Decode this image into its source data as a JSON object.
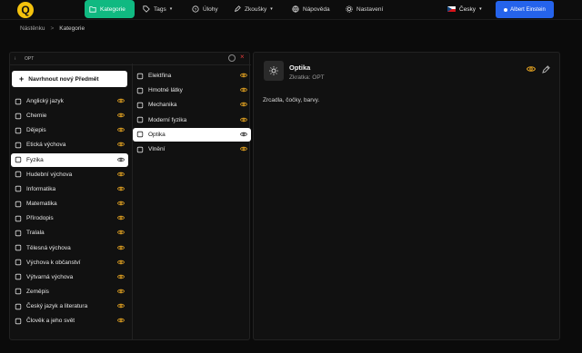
{
  "nav": {
    "items": [
      {
        "label": "Kategorie",
        "icon": "folder-icon"
      },
      {
        "label": "Tags",
        "icon": "tag-icon"
      },
      {
        "label": "Úlohy",
        "icon": "help-circle-icon"
      },
      {
        "label": "Zkoušky",
        "icon": "pen-icon"
      },
      {
        "label": "Nápověda",
        "icon": "globe-icon"
      },
      {
        "label": "Nastavení",
        "icon": "gear-icon"
      }
    ],
    "language": "Česky",
    "user": "Albert Einstein"
  },
  "breadcrumb": {
    "home": "Nástěnku",
    "current": "Kategorie"
  },
  "panel": {
    "code": "OPT",
    "new_button": "Navrhnout nový Předmět"
  },
  "subjects": [
    {
      "label": "Anglický jazyk",
      "icon": "translate-icon"
    },
    {
      "label": "Chemie",
      "icon": "flask-icon"
    },
    {
      "label": "Dějepis",
      "icon": "scroll-icon"
    },
    {
      "label": "Etická výchova",
      "icon": "heart-icon"
    },
    {
      "label": "Fyzika",
      "icon": "sparkles-icon",
      "selected": true
    },
    {
      "label": "Hudební výchova",
      "icon": "music-note-icon"
    },
    {
      "label": "Informatika",
      "icon": "server-icon"
    },
    {
      "label": "Matematika",
      "icon": "calculator-icon"
    },
    {
      "label": "Přírodopis",
      "icon": "animal-icon"
    },
    {
      "label": "Tralala",
      "icon": "book-icon"
    },
    {
      "label": "Tělesná výchova",
      "icon": "trophy-icon"
    },
    {
      "label": "Výchova k občanství",
      "icon": "users-icon"
    },
    {
      "label": "Výtvarná výchova",
      "icon": "palette-icon"
    },
    {
      "label": "Zeměpis",
      "icon": "map-icon"
    },
    {
      "label": "Český jazyk a literatura",
      "icon": "open-book-icon"
    },
    {
      "label": "Člověk a jeho svět",
      "icon": "earth-icon"
    }
  ],
  "subcategories": [
    {
      "label": "Elektřina",
      "icon": "battery-icon"
    },
    {
      "label": "Hmotné látky",
      "icon": "cube-icon"
    },
    {
      "label": "Mechanika",
      "icon": "cog-icon"
    },
    {
      "label": "Moderní fyzika",
      "icon": "cloud-icon"
    },
    {
      "label": "Optika",
      "icon": "sun-icon",
      "selected": true
    },
    {
      "label": "Vlnění",
      "icon": "bulb-icon"
    }
  ],
  "detail": {
    "title": "Optika",
    "code_line": "Zkratka: OPT",
    "description": "Zrcadla, čočky, barvy."
  },
  "colors": {
    "accent": "#10b981",
    "primary": "#2563eb",
    "eye": "#e0a021",
    "danger": "#e23b3b"
  }
}
